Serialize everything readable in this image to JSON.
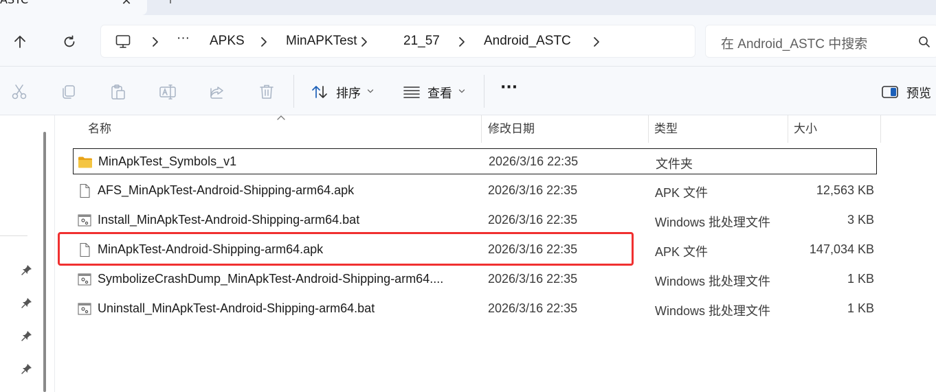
{
  "window": {
    "tab_title": "ASTC",
    "tab_close": "✕",
    "tab_new": "+"
  },
  "nav": {
    "breadcrumb": [
      "APKS",
      "MinAPKTest",
      "21_57",
      "Android_ASTC"
    ],
    "more": "···"
  },
  "search": {
    "placeholder": "在 Android_ASTC 中搜索"
  },
  "toolbar": {
    "sort_label": "排序",
    "view_label": "查看",
    "more_label": "···",
    "preview_label": "预览"
  },
  "columns": {
    "name": "名称",
    "date": "修改日期",
    "type": "类型",
    "size": "大小"
  },
  "files": [
    {
      "name": "MinApkTest_Symbols_v1",
      "date": "2026/3/16 22:35",
      "type": "文件夹",
      "size": "",
      "icon": "folder-icon"
    },
    {
      "name": "AFS_MinApkTest-Android-Shipping-arm64.apk",
      "date": "2026/3/16 22:35",
      "type": "APK 文件",
      "size": "12,563 KB",
      "icon": "file-icon"
    },
    {
      "name": "Install_MinApkTest-Android-Shipping-arm64.bat",
      "date": "2026/3/16 22:35",
      "type": "Windows 批处理文件",
      "size": "3 KB",
      "icon": "batch-file-icon"
    },
    {
      "name": "MinApkTest-Android-Shipping-arm64.apk",
      "date": "2026/3/16 22:35",
      "type": "APK 文件",
      "size": "147,034 KB",
      "icon": "file-icon"
    },
    {
      "name": "SymbolizeCrashDump_MinApkTest-Android-Shipping-arm64....",
      "date": "2026/3/16 22:35",
      "type": "Windows 批处理文件",
      "size": "1 KB",
      "icon": "batch-file-icon"
    },
    {
      "name": "Uninstall_MinApkTest-Android-Shipping-arm64.bat",
      "date": "2026/3/16 22:35",
      "type": "Windows 批处理文件",
      "size": "1 KB",
      "icon": "batch-file-icon"
    }
  ],
  "colors": {
    "highlight": "#f03030",
    "folder": "#f4c542"
  }
}
